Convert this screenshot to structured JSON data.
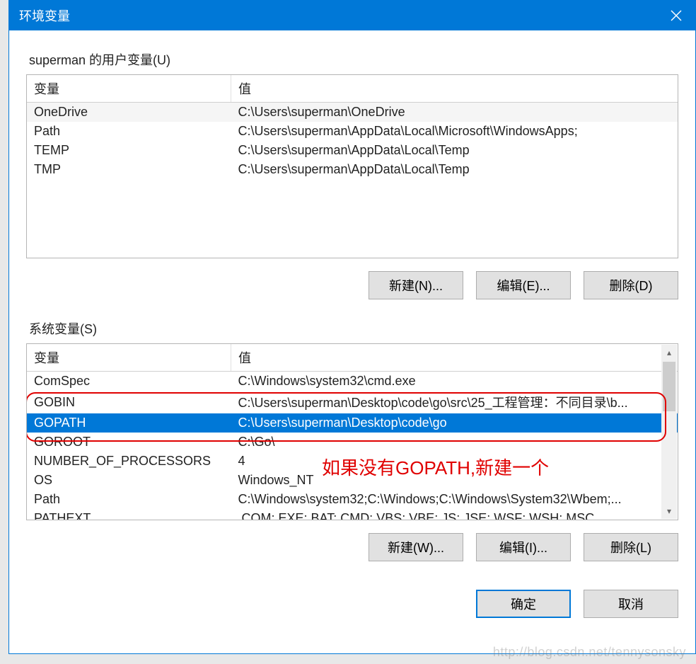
{
  "titlebar": {
    "title": "环境变量"
  },
  "user_group": {
    "label": "superman 的用户变量(U)",
    "headers": {
      "var": "变量",
      "val": "值"
    },
    "rows": [
      {
        "var": "OneDrive",
        "val": "C:\\Users\\superman\\OneDrive"
      },
      {
        "var": "Path",
        "val": "C:\\Users\\superman\\AppData\\Local\\Microsoft\\WindowsApps;"
      },
      {
        "var": "TEMP",
        "val": "C:\\Users\\superman\\AppData\\Local\\Temp"
      },
      {
        "var": "TMP",
        "val": "C:\\Users\\superman\\AppData\\Local\\Temp"
      }
    ],
    "buttons": {
      "new": "新建(N)...",
      "edit": "编辑(E)...",
      "delete": "删除(D)"
    }
  },
  "sys_group": {
    "label": "系统变量(S)",
    "headers": {
      "var": "变量",
      "val": "值"
    },
    "rows": [
      {
        "var": "ComSpec",
        "val": "C:\\Windows\\system32\\cmd.exe"
      },
      {
        "var": "GOBIN",
        "val": "C:\\Users\\superman\\Desktop\\code\\go\\src\\25_工程管理：不同目录\\b..."
      },
      {
        "var": "GOPATH",
        "val": "C:\\Users\\superman\\Desktop\\code\\go",
        "selected": true
      },
      {
        "var": "GOROOT",
        "val": "C:\\Go\\"
      },
      {
        "var": "NUMBER_OF_PROCESSORS",
        "val": "4"
      },
      {
        "var": "OS",
        "val": "Windows_NT"
      },
      {
        "var": "Path",
        "val": "C:\\Windows\\system32;C:\\Windows;C:\\Windows\\System32\\Wbem;..."
      },
      {
        "var": "PATHEXT",
        "val": ".COM;.EXE;.BAT;.CMD;.VBS;.VBE;.JS;.JSE;.WSF;.WSH;.MSC"
      }
    ],
    "buttons": {
      "new": "新建(W)...",
      "edit": "编辑(I)...",
      "delete": "删除(L)"
    }
  },
  "footer": {
    "ok": "确定",
    "cancel": "取消"
  },
  "annotation": "如果没有GOPATH,新建一个",
  "watermark": "http://blog.csdn.net/tennysonsky"
}
